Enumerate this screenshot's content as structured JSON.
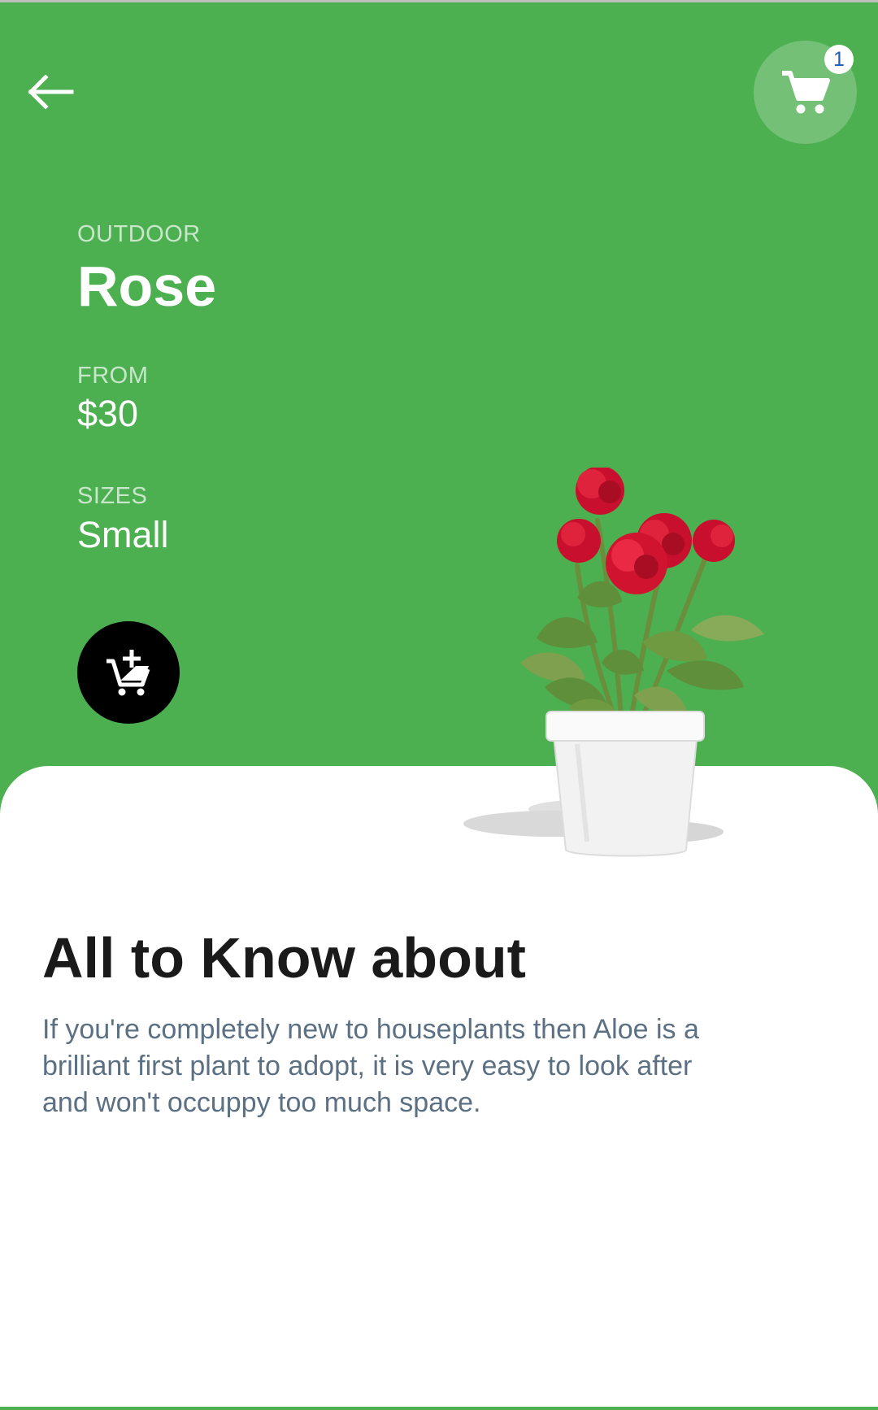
{
  "header": {
    "back_icon": "arrow-left-icon",
    "cart_icon": "shopping-cart-icon",
    "cart_count": "1"
  },
  "product": {
    "category": "OUTDOOR",
    "name": "Rose",
    "price_label": "FROM",
    "price": "$30",
    "sizes_label": "SIZES",
    "size": "Small",
    "add_to_cart_icon": "add-shopping-cart-icon"
  },
  "about": {
    "title": "All to Know about",
    "text": "If you're completely new to houseplants then Aloe is a\n brilliant first plant to adopt, it is very easy to look after\n and won't occuppy too much space."
  },
  "colors": {
    "primary": "#4caf50",
    "dark": "#000000",
    "body_text": "#5b7083",
    "badge_text": "#1e5fb3"
  }
}
